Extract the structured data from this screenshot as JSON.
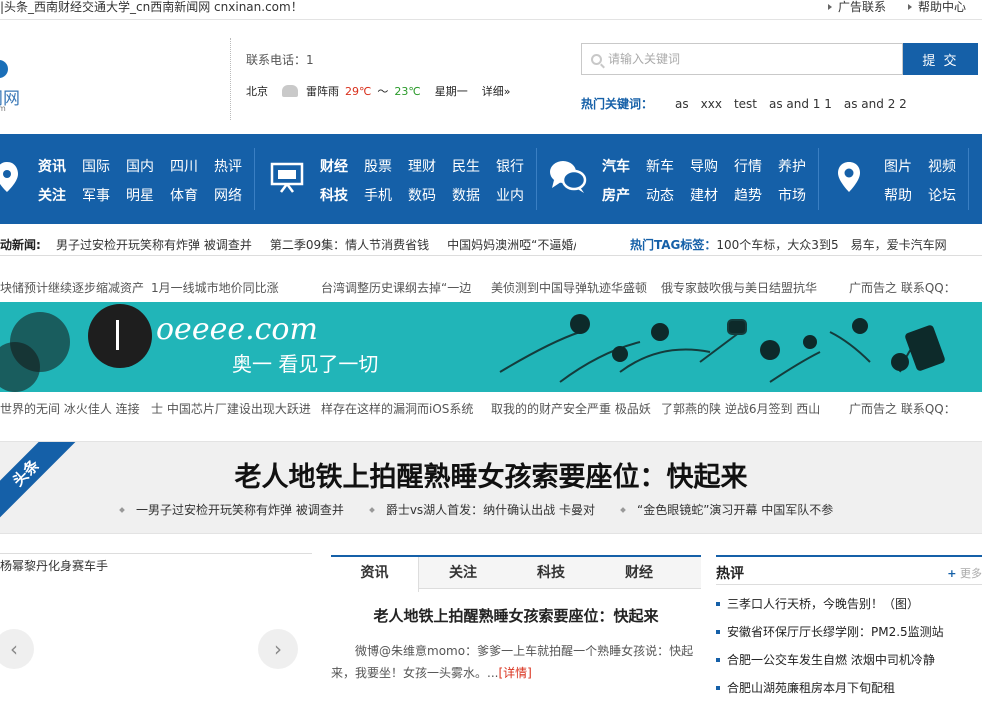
{
  "topbar": {
    "notice": "|头条_西南财经交通大学_cn西南新闻网 cnxinan.com！",
    "links": [
      "广告联系",
      "帮助中心"
    ]
  },
  "logo": {
    "text": "闻网",
    "sub": "m"
  },
  "contact": "联系电话：1",
  "weather": {
    "city": "北京",
    "condition": "雷阵雨",
    "high": "29℃",
    "tilde": "～",
    "low": "23℃",
    "weekday": "星期一",
    "detail": "详细»"
  },
  "search": {
    "placeholder": "请输入关键词",
    "button": "提 交"
  },
  "hot_keywords": {
    "label": "热门关键词：",
    "items": [
      "as",
      "xxx",
      "test",
      "as and 1 1",
      "as and 2 2"
    ]
  },
  "nav": {
    "groups": [
      {
        "icon": "location-icon",
        "rows": [
          [
            "资讯",
            "国际",
            "国内",
            "四川",
            "热评"
          ],
          [
            "关注",
            "军事",
            "明星",
            "体育",
            "网络"
          ]
        ]
      },
      {
        "icon": "monitor-icon",
        "rows": [
          [
            "财经",
            "股票",
            "理财",
            "民生",
            "银行"
          ],
          [
            "科技",
            "手机",
            "数码",
            "数据",
            "业内"
          ]
        ]
      },
      {
        "icon": "chat-icon",
        "rows": [
          [
            "汽车",
            "新车",
            "导购",
            "行情",
            "养护"
          ],
          [
            "房产",
            "动态",
            "建材",
            "趋势",
            "市场"
          ]
        ]
      },
      {
        "icon": "map-pin-icon",
        "rows": [
          [
            "图片",
            "视频"
          ],
          [
            "帮助",
            "论坛"
          ]
        ]
      }
    ]
  },
  "ticker": {
    "label": "动新闻:",
    "items": [
      "男子过安检开玩笑称有炸弹 被调查并",
      "第二季09集：情人节消费省钱",
      "中国妈妈澳洲啞“不逼婚/"
    ],
    "tag_label": "热门TAG标签：",
    "tags": "100个车标，大众3到5　易车，爱卡汽车网"
  },
  "linkrow1": [
    "块储预计继续逐步缩减资产",
    "1月一线城市地价同比涨",
    "台湾调整历史课纲去掉“一边",
    "美侦测到中国导弹轨迹华盛顿",
    "俄专家鼓吹俄与美日结盟抗华",
    "广而告之 联系QQ："
  ],
  "banner": {
    "brand": "oeeee.com",
    "slogan": "奥一 看见了一切",
    "numeral": "1"
  },
  "linkrow2": [
    "世界的无间 冰火佳人 连接",
    "士 中国芯片厂建设出现大跃进",
    "样存在这样的漏洞而iOS系统",
    "取我的的财产安全严重 极品妖",
    "了郭燕的陕 逆战6月签到 西山",
    "广而告之 联系QQ："
  ],
  "headline": {
    "ribbon": "头条",
    "title": "老人地铁上拍醒熟睡女孩索要座位：快起来",
    "subs": [
      "一男子过安检开玩笑称有炸弹 被调查并",
      "爵士vs湖人首发：纳什确认出战 卡曼对",
      "“金色眼镜蛇”演习开幕 中国军队不参"
    ]
  },
  "slider": {
    "caption": "杨幂黎丹化身赛车手",
    "prev": "‹",
    "next": "›"
  },
  "tabs": [
    "资讯",
    "关注",
    "科技",
    "财经"
  ],
  "article": {
    "title": "老人地铁上拍醒熟睡女孩索要座位：快起来",
    "body": "微博@朱维意momo：爹爹一上车就拍醒一个熟睡女孩说：快起来，我要坐！女孩一头雾水。...",
    "more": "[详情]"
  },
  "hotcomments": {
    "title": "热评",
    "more_plus": "+",
    "more": " 更多",
    "items": [
      "三孝口人行天桥，今晚告别！（图）",
      "安徽省环保厅厅长缪学刚：PM2.5监测站",
      "合肥一公交车发生自燃 浓烟中司机冷静",
      "合肥山湖苑廉租房本月下旬配租"
    ]
  }
}
